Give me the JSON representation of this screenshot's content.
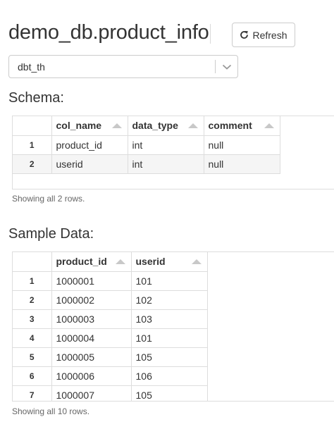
{
  "header": {
    "title": "demo_db.product_info",
    "refresh_label": "Refresh"
  },
  "database_select": {
    "value": "dbt_th"
  },
  "schema": {
    "title": "Schema:",
    "columns": [
      "col_name",
      "data_type",
      "comment"
    ],
    "rows": [
      {
        "index": "1",
        "cells": [
          "product_id",
          "int",
          "null"
        ]
      },
      {
        "index": "2",
        "cells": [
          "userid",
          "int",
          "null"
        ]
      }
    ],
    "footer": "Showing all 2 rows."
  },
  "sample": {
    "title": "Sample Data:",
    "columns": [
      "product_id",
      "userid"
    ],
    "rows": [
      {
        "index": "1",
        "cells": [
          "1000001",
          "101"
        ]
      },
      {
        "index": "2",
        "cells": [
          "1000002",
          "102"
        ]
      },
      {
        "index": "3",
        "cells": [
          "1000003",
          "103"
        ]
      },
      {
        "index": "4",
        "cells": [
          "1000004",
          "101"
        ]
      },
      {
        "index": "5",
        "cells": [
          "1000005",
          "105"
        ]
      },
      {
        "index": "6",
        "cells": [
          "1000006",
          "106"
        ]
      },
      {
        "index": "7",
        "cells": [
          "1000007",
          "105"
        ]
      }
    ],
    "footer": "Showing all 10 rows."
  },
  "icons": {
    "refresh": "refresh-icon",
    "chevron": "chevron-down-icon",
    "sort": "sort-asc-icon"
  }
}
